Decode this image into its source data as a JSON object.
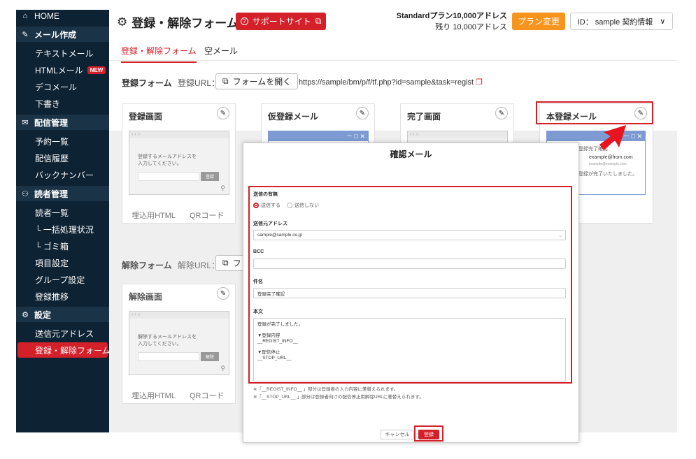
{
  "sidebar": {
    "home": "HOME",
    "sections": [
      {
        "label": "メール作成",
        "items": [
          "テキストメール",
          "HTMLメール",
          "デコメール",
          "下書き"
        ]
      },
      {
        "label": "配信管理",
        "items": [
          "予約一覧",
          "配信履歴",
          "バックナンバー"
        ]
      },
      {
        "label": "読者管理",
        "items": [
          "読者一覧",
          "└ 一括処理状況",
          "└ ゴミ箱",
          "項目設定",
          "グループ設定",
          "登録推移"
        ]
      },
      {
        "label": "設定",
        "items": [
          "送信元アドレス",
          "登録・解除フォーム"
        ]
      }
    ],
    "new_badge": "NEW"
  },
  "header": {
    "title": "登録・解除フォーム",
    "support": "サポートサイト",
    "plan_line1": "Standardプラン10,000アドレス",
    "plan_line2": "残り 10,000アドレス",
    "plan_change": "プラン変更",
    "id_label": "ID： sample 契約情報"
  },
  "tabs": [
    "登録・解除フォーム",
    "空メール"
  ],
  "register": {
    "label": "登録フォーム",
    "url_label": "登録URL：",
    "open_button": "フォームを開く",
    "url": "https://sample/bm/p/f/tf.php?id=sample&task=regist",
    "cards": [
      "登録画面",
      "仮登録メール",
      "完了画面",
      "本登録メール"
    ],
    "mini_text": "登録するメールアドレスを\n入力してください。",
    "mini_button": "登録",
    "footer": [
      "埋込用HTML",
      "QRコード"
    ],
    "mail_preview": [
      "登録完了確認",
      "example@from.com",
      "example@example.com",
      "登録が完了いたしました。"
    ]
  },
  "unregister": {
    "label": "解除フォーム",
    "url_label": "解除URL：",
    "open_button": "フ",
    "card": "解除画面",
    "mini_text": "解除するメールアドレスを\n入力してください。",
    "mini_button": "解除",
    "footer": [
      "埋込用HTML",
      "QRコード"
    ]
  },
  "modal": {
    "title": "確認メール",
    "send_label": "送信の有無",
    "send_on": "送信する",
    "send_off": "送信しない",
    "from_label": "送信元アドレス",
    "from_value": "sample@sample.co.jp",
    "bcc_label": "BCC",
    "bcc_value": "",
    "subject_label": "件名",
    "subject_value": "登録完了確認",
    "body_label": "本文",
    "body_lines": [
      "登録が完了しました。",
      "",
      "▼登録内容",
      "__REGIST_INFO__",
      "",
      "▼配信停止",
      "__STOP_URL__"
    ],
    "note1": "※「__REGIST_INFO__ 」部分は登録者の入力内容に差替えられます。",
    "note2": "※「__STOP_URL__ 」部分は登録者向けの配信停止用解除URLに差替えられます。",
    "cancel": "キャンセル",
    "submit": "登録"
  },
  "colors": {
    "accent": "#d32029",
    "sidebar": "#0d2233",
    "plan_button": "#f7941d"
  }
}
